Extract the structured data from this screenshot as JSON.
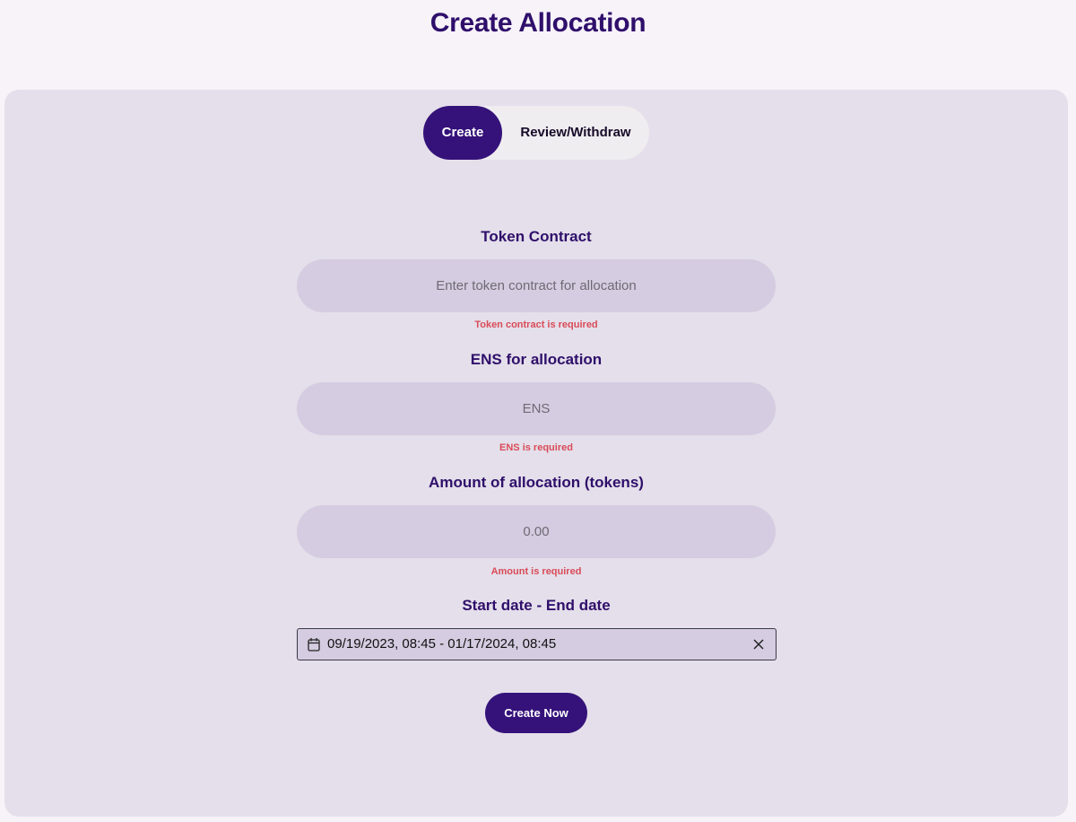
{
  "header": {
    "title": "Create Allocation"
  },
  "tabs": {
    "create_label": "Create",
    "review_label": "Review/Withdraw",
    "active": "Create"
  },
  "form": {
    "token_contract": {
      "label": "Token Contract",
      "placeholder": "Enter token contract for allocation",
      "value": "",
      "error": "Token contract is required"
    },
    "ens": {
      "label": "ENS for allocation",
      "placeholder": "ENS",
      "value": "",
      "error": "ENS is required"
    },
    "amount": {
      "label": "Amount of allocation (tokens)",
      "placeholder": "0.00",
      "value": "",
      "error": "Amount is required"
    },
    "date_range": {
      "label": "Start date - End date",
      "value": "09/19/2023, 08:45 - 01/17/2024, 08:45",
      "icon": "calendar-icon",
      "clear_icon": "close-icon"
    },
    "submit_label": "Create Now"
  },
  "colors": {
    "brand": "#35127a",
    "title": "#2f0f6b",
    "error": "#d94b58",
    "panel": "#e4dfea",
    "input_bg": "#d5cce1",
    "page_bg": "#f7f3f9"
  }
}
